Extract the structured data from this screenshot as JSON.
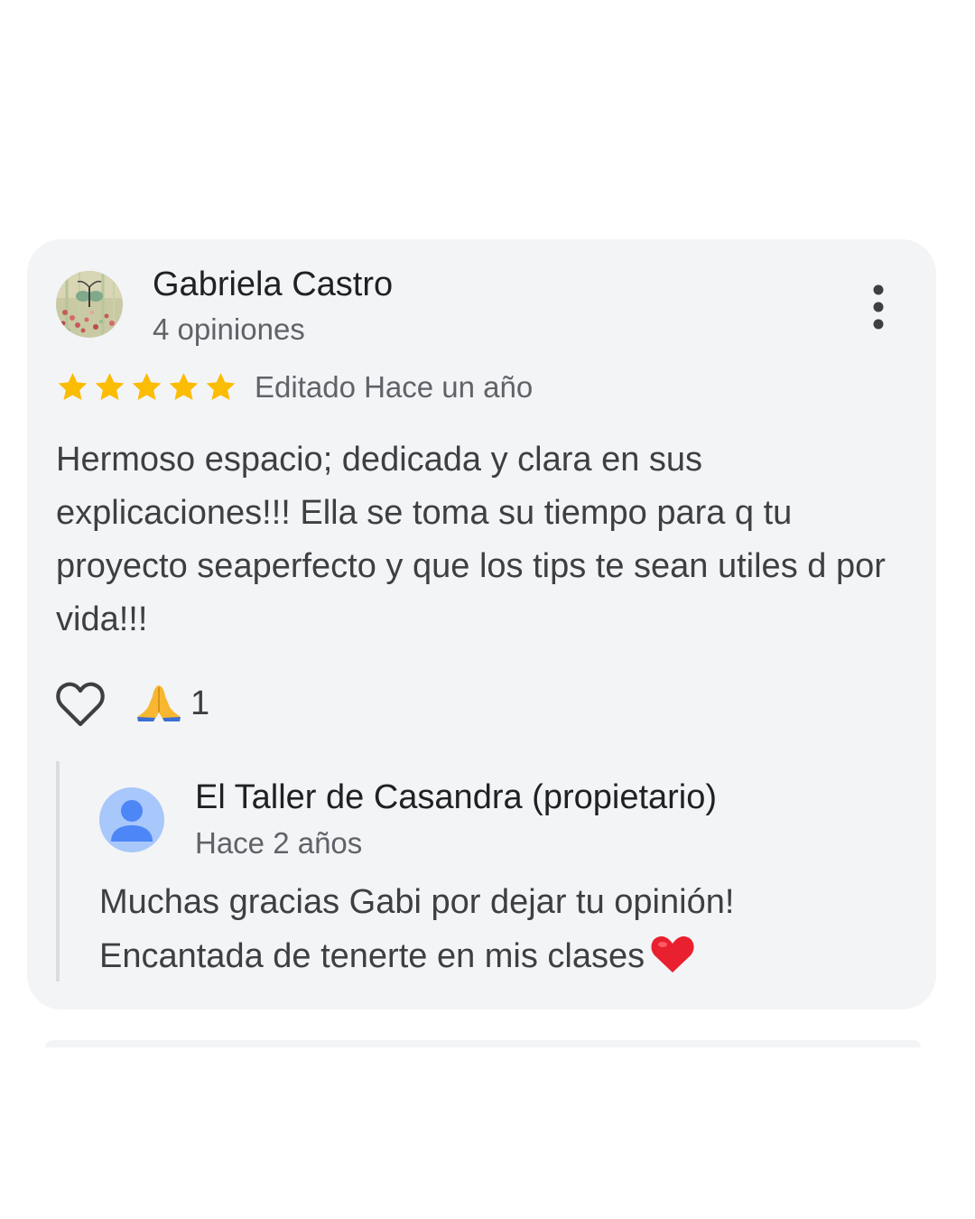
{
  "review": {
    "author_name": "Gabriela Castro",
    "author_review_count": "4 opiniones",
    "rating": 5,
    "rating_max": 5,
    "edited_label": "Editado Hace un año",
    "text": "Hermoso espacio; dedicada y clara en sus explicaciones!!! Ella se toma su tiempo para q tu proyecto seaperfecto y que los tips te sean utiles d por vida!!!",
    "reaction_count": "1"
  },
  "owner_reply": {
    "name": "El Taller de Casandra (propietario)",
    "time": "Hace 2 años",
    "text": "Muchas gracias Gabi por dejar tu opinión! Encantada de tenerte en mis clases"
  },
  "icons": {
    "more": "more-vert-icon",
    "star": "star-icon",
    "like": "heart-outline-icon",
    "reaction": "folded-hands-emoji",
    "owner_avatar": "default-person-avatar",
    "reply_heart": "red-heart-emoji"
  },
  "colors": {
    "card_background": "#f3f4f6",
    "star": "#fbbc04",
    "primary_text": "#202124",
    "secondary_text": "#5f6368",
    "body_text": "#3c4043",
    "reply_bar": "#dadce0",
    "owner_avatar_bg": "#a8c7fa",
    "owner_avatar_fg": "#4d86f7",
    "heart": "#e8202f"
  }
}
